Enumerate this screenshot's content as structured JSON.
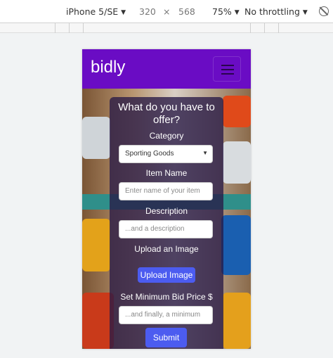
{
  "devtools": {
    "device": "iPhone 5/SE",
    "width": "320",
    "times": "×",
    "height": "568",
    "zoom": "75%",
    "throttle": "No throttling",
    "rotate_icon": "rotate-icon"
  },
  "navbar": {
    "brand": "bidly",
    "toggler_icon": "hamburger-menu-icon"
  },
  "form": {
    "title": "What do you have to offer?",
    "category_label": "Category",
    "category_value": "Sporting Goods",
    "item_name_label": "Item Name",
    "item_name_placeholder": "Enter name of your item",
    "description_label": "Description",
    "description_placeholder": "...and a description",
    "upload_label": "Upload an Image",
    "upload_button": "Upload Image",
    "min_bid_label": "Set Minimum Bid Price $",
    "min_bid_placeholder": "...and finally, a minimum",
    "submit_button": "Submit"
  },
  "colors": {
    "navbar": "#6a0cc4",
    "button": "#4c5cf0"
  }
}
